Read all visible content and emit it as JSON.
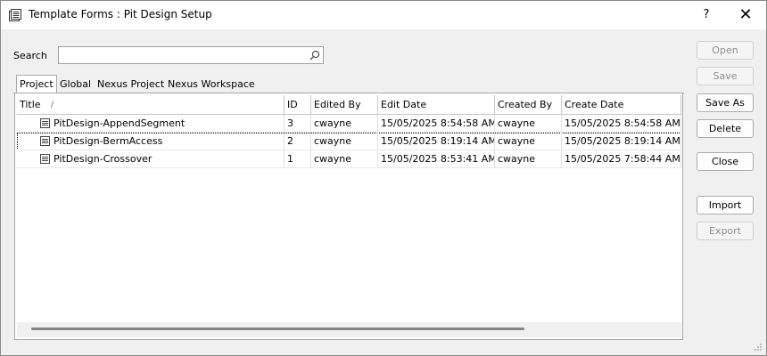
{
  "window": {
    "title": "Template Forms : Pit Design Setup",
    "help_label": "?",
    "close_label": "✕"
  },
  "search": {
    "label": "Search",
    "value": "",
    "placeholder": ""
  },
  "tabs": [
    {
      "label": "Project",
      "active": true
    },
    {
      "label": "Global",
      "active": false
    },
    {
      "label": "Nexus Project",
      "active": false
    },
    {
      "label": "Nexus Workspace",
      "active": false
    }
  ],
  "table": {
    "columns": [
      "Title",
      "ID",
      "Edited By",
      "Edit Date",
      "Created By",
      "Create Date"
    ],
    "sort_indicator": "/",
    "rows": [
      {
        "title": "PitDesign-AppendSegment",
        "id": "3",
        "edited_by": "cwayne",
        "edit_date": "15/05/2025 8:54:58 AM",
        "created_by": "cwayne",
        "create_date": "15/05/2025 8:54:58 AM"
      },
      {
        "title": "PitDesign-BermAccess",
        "id": "2",
        "edited_by": "cwayne",
        "edit_date": "15/05/2025 8:19:14 AM",
        "created_by": "cwayne",
        "create_date": "15/05/2025 8:19:14 AM"
      },
      {
        "title": "PitDesign-Crossover",
        "id": "1",
        "edited_by": "cwayne",
        "edit_date": "15/05/2025 8:53:41 AM",
        "created_by": "cwayne",
        "create_date": "15/05/2025 7:58:44 AM"
      }
    ],
    "selected_row": 1
  },
  "buttons": {
    "open": "Open",
    "save": "Save",
    "save_as": "Save As",
    "delete": "Delete",
    "close": "Close",
    "import": "Import",
    "export": "Export"
  },
  "icons": {
    "app": "form-window-icon",
    "search": "search-icon",
    "row": "form-template-icon"
  }
}
